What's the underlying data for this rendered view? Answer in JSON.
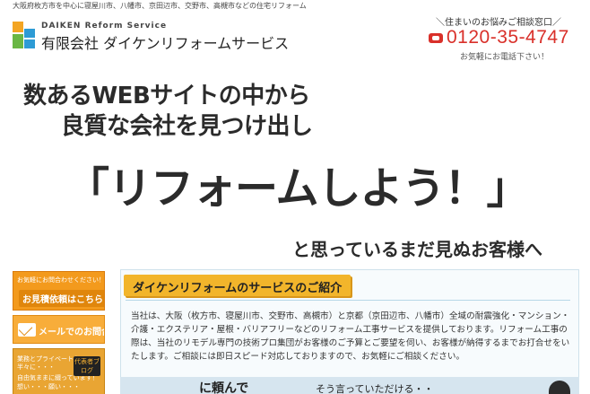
{
  "header": {
    "tagline": "大阪府枚方市を中心に寝屋川市、八幡市、京田辺市、交野市、高槻市などの住宅リフォーム",
    "logo_en": "DAIKEN Reform Service",
    "logo_ja": "有限会社 ダイケンリフォームサービス",
    "contact_top": "＼住まいのお悩みご相談窓口／",
    "phone": "0120-35-4747",
    "contact_bottom": "お気軽にお電話下さい！"
  },
  "hero": {
    "line1": "数あるWEBサイトの中から",
    "line2": "良質な会社を見つけ出し",
    "big": "「リフォームしよう！」",
    "line3": "と思っているまだ見ぬお客様へ"
  },
  "sidebar": {
    "quote_tag": "お気軽にお問合わせください！",
    "quote_label": "お見積依頼はこちら",
    "mail_label": "メールでのお問合せ",
    "blog_line1": "業務とプライベートを",
    "blog_line2": "半々に・・・",
    "blog_line3": "自由気ままに綴っています！",
    "blog_line4": "想い・・・願い・・・",
    "blog_badge": "代表者ブログ"
  },
  "main": {
    "section_title": "ダイケンリフォームのサービスのご紹介",
    "body": "当社は、大阪（枚方市、寝屋川市、交野市、高槻市）と京都（京田辺市、八幡市）全域の耐震強化・マンション・介護・エクステリア・屋根・バリアフリーなどのリフォーム工事サービスを提供しております。リフォーム工事の際は、当社のリモデル専門の技術プロ集団がお客様のご予算とご要望を伺い、お客様が納得するまでお打合せをいたします。ご相談には即日スピード対応しておりますので、お気軽にご相談ください。"
  },
  "bottom": {
    "text1": "に頼んで",
    "text2": "そう言っていただける・・"
  },
  "colors": {
    "accent_red": "#d9302a",
    "accent_orange": "#f39a1d",
    "title_yellow": "#f2b52b",
    "box_blue": "#cfe2ec"
  }
}
